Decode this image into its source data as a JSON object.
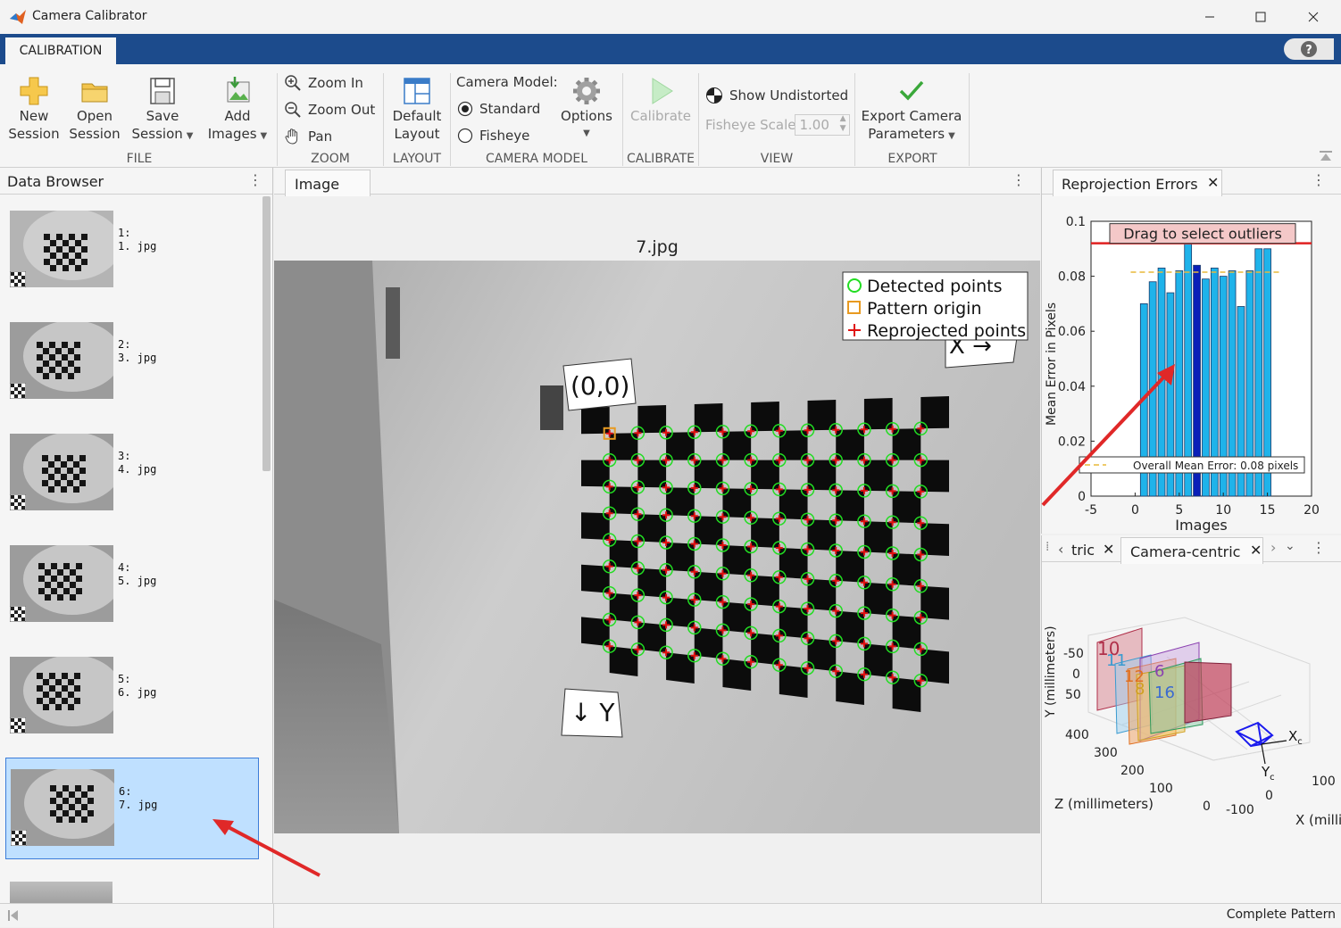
{
  "window": {
    "title": "Camera Calibrator"
  },
  "ribbon": {
    "tab": "CALIBRATION",
    "file": {
      "new_session": [
        "New",
        "Session"
      ],
      "open_session": [
        "Open",
        "Session"
      ],
      "save_session": [
        "Save",
        "Session"
      ],
      "add_images": [
        "Add",
        "Images"
      ],
      "group": "FILE"
    },
    "zoom": {
      "zoom_in": "Zoom In",
      "zoom_out": "Zoom Out",
      "pan": "Pan",
      "group": "ZOOM"
    },
    "layout": {
      "default_layout": [
        "Default",
        "Layout"
      ],
      "group": "LAYOUT"
    },
    "camera_model": {
      "label": "Camera Model:",
      "standard": "Standard",
      "fisheye": "Fisheye",
      "selected": "Standard",
      "options": "Options",
      "group": "CAMERA MODEL"
    },
    "calibrate": {
      "calibrate": "Calibrate",
      "group": "CALIBRATE"
    },
    "view": {
      "show_undistorted": "Show Undistorted",
      "fisheye_scale_label": "Fisheye Scale",
      "fisheye_scale_value": "1.00",
      "group": "VIEW"
    },
    "export": {
      "export_params": [
        "Export Camera",
        "Parameters"
      ],
      "group": "EXPORT"
    }
  },
  "data_browser": {
    "title": "Data Browser",
    "items": [
      {
        "index": "1:",
        "file": "1. jpg",
        "selected": false
      },
      {
        "index": "2:",
        "file": "3. jpg",
        "selected": false
      },
      {
        "index": "3:",
        "file": "4. jpg",
        "selected": false
      },
      {
        "index": "4:",
        "file": "5. jpg",
        "selected": false
      },
      {
        "index": "5:",
        "file": "6. jpg",
        "selected": false
      },
      {
        "index": "6:",
        "file": "7. jpg",
        "selected": true
      }
    ]
  },
  "image_panel": {
    "tab": "Image",
    "image_title": "7.jpg",
    "origin_label": "(0,0)",
    "x_label": "X →",
    "y_label": "↓ Y",
    "legend": [
      "Detected points",
      "Pattern origin",
      "Reprojected points"
    ]
  },
  "reprojection_panel": {
    "tab": "Reprojection Errors",
    "drag_label": "Drag to select outliers",
    "mean_error_label": "Overall Mean Error: 0.08 pixels",
    "ylabel": "Mean Error in Pixels",
    "xlabel": "Images",
    "yticks": [
      "0",
      "0.02",
      "0.04",
      "0.06",
      "0.08",
      "0.1"
    ],
    "xticks": [
      "-5",
      "0",
      "5",
      "10",
      "15",
      "20"
    ]
  },
  "extrinsics_panel": {
    "tab_partial": "tric",
    "tab_active": "Camera-centric",
    "ylabel": "Y (millimeters)",
    "zlabel": "Z (millimeters)",
    "xlabel": "X (milli",
    "yticks": [
      "-50",
      "0",
      "50"
    ],
    "zticks": [
      "400",
      "300",
      "200",
      "100",
      "0"
    ],
    "xticks": [
      "100",
      "0",
      "-100"
    ],
    "board_labels": [
      "10",
      "11",
      "12",
      "6",
      "8",
      "16"
    ],
    "axis_xc": "X",
    "axis_yc": "Y",
    "axis_sub": "c"
  },
  "status": {
    "text": "Complete Pattern"
  },
  "chart_data": {
    "type": "bar",
    "categories": [
      1,
      2,
      3,
      4,
      5,
      6,
      7,
      8,
      9,
      10,
      11,
      12,
      13,
      14,
      15
    ],
    "values": [
      0.07,
      0.078,
      0.083,
      0.074,
      0.082,
      0.098,
      0.084,
      0.079,
      0.083,
      0.08,
      0.082,
      0.069,
      0.082,
      0.09,
      0.09
    ],
    "highlighted_index": 6,
    "overall_mean": 0.0815,
    "outlier_threshold": 0.092,
    "xlim": [
      -5,
      20
    ],
    "ylim": [
      0,
      0.1
    ],
    "xlabel": "Images",
    "ylabel": "Mean Error in Pixels",
    "bar_color": "#1fb3ea",
    "highlight_color": "#0a1fb8",
    "mean_line_color": "#e8b838",
    "threshold_color": "#e02020"
  },
  "colors": {
    "ribbon_tab_bar": "#1c4b8c",
    "selected_item": "#bfe0ff",
    "detected": "#22dd22",
    "origin": "#e89a20",
    "reprojected": "#e01010"
  }
}
